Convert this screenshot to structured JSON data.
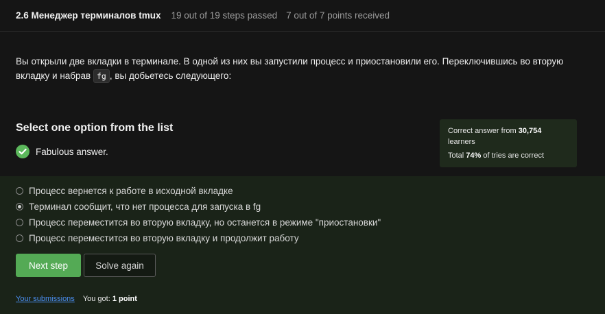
{
  "header": {
    "title": "2.6 Менеджер терминалов tmux",
    "steps": "19 out of 19 steps passed",
    "points": "7 out of 7 points  received"
  },
  "question": {
    "text_before": "Вы открыли две вкладки в терминале. В одной из них вы запустили процесс и приостановили его. Переключившись во вторую вкладку и набрав ",
    "code": "fg",
    "text_after": ", вы добьетесь следующего:"
  },
  "select_title": "Select one option from the list",
  "feedback": {
    "text": "Fabulous answer.",
    "icon": "check-circle-icon",
    "color": "#5cb85c"
  },
  "stats": {
    "line1_prefix": "Correct answer from ",
    "learners_count": "30,754",
    "line1_suffix": " learners",
    "line2_prefix": "Total ",
    "percent": "74%",
    "line2_suffix": " of tries are correct"
  },
  "options": [
    {
      "label": "Процесс вернется к работе в исходной вкладке",
      "selected": false
    },
    {
      "label": "Терминал сообщит, что нет процесса для запуска в fg",
      "selected": true
    },
    {
      "label": "Процесс переместится во вторую вкладку, но останется в режиме \"приостановки\"",
      "selected": false
    },
    {
      "label": "Процесс переместится во вторую вкладку и продолжит работу",
      "selected": false
    }
  ],
  "buttons": {
    "next": "Next step",
    "solve": "Solve again"
  },
  "footer": {
    "submissions_link": "Your submissions",
    "got_prefix": "You got: ",
    "got_value": "1 point"
  },
  "colors": {
    "background": "#151515",
    "options_background": "#1a2318",
    "accent_green": "#54aa55",
    "link": "#4b8ff2"
  }
}
